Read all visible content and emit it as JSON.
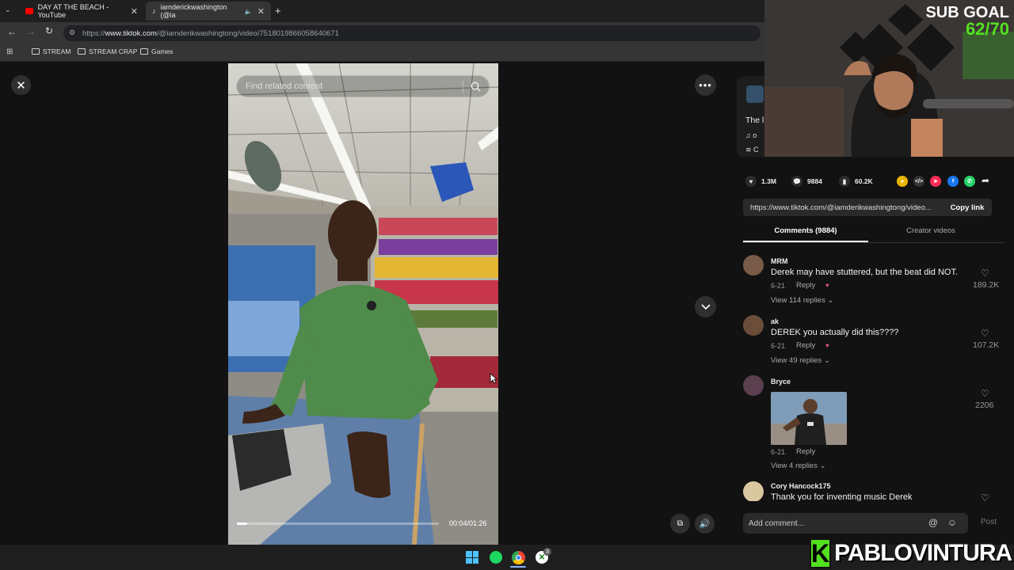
{
  "browser": {
    "tabs": [
      {
        "title": "DAY AT THE BEACH - YouTube",
        "icon": "youtube-icon"
      },
      {
        "title": "iamderickwashington (@ia",
        "icon": "tiktok-icon"
      }
    ],
    "url_prefix": "https://",
    "url_domain": "www.tiktok.com",
    "url_path": "/@iamderikwashingtong/video/7518019866058640671",
    "bookmarks": [
      "STREAM",
      "STREAM CRAP",
      "Games"
    ]
  },
  "video": {
    "search_placeholder": "Find related content",
    "time": "00:04/01:26",
    "progress": 0.05
  },
  "info": {
    "caption": "The l",
    "sound": "o",
    "collection": "C"
  },
  "stats": {
    "likes": "1.3M",
    "comments": "9884",
    "saves": "60.2K"
  },
  "share_link": "https://www.tiktok.com/@iamderikwashingtong/video...",
  "copy_label": "Copy link",
  "tabs": {
    "comments": "Comments (9884)",
    "creator": "Creator videos"
  },
  "comments": [
    {
      "name": "MRM",
      "text": "Derek may have stuttered, but the beat did NOT.",
      "date": "6-21",
      "reply": "Reply",
      "likes": "189.2K",
      "view": "View 114 replies"
    },
    {
      "name": "ak",
      "text": "DEREK you actually did this????",
      "date": "6-21",
      "reply": "Reply",
      "likes": "107.2K",
      "view": "View 49 replies"
    },
    {
      "name": "Bryce",
      "text": "",
      "date": "6-21",
      "reply": "Reply",
      "likes": "2206",
      "view": "View 4 replies"
    },
    {
      "name": "Cory Hancock175",
      "text": "Thank you for inventing music Derek",
      "date": "",
      "reply": "",
      "likes": "",
      "view": ""
    }
  ],
  "add_comment_placeholder": "Add comment...",
  "post_label": "Post",
  "overlay": {
    "sub_goal_title": "SUB GOAL",
    "sub_goal_value": "62/70",
    "brand_letter": "K",
    "brand_name": "PABLOVINTURA"
  },
  "taskbar": {
    "xbox_badge": "3"
  },
  "colors": {
    "accent_green": "#53e01f",
    "tiktok_bg": "#121212",
    "youtube_red": "#ff0000"
  }
}
